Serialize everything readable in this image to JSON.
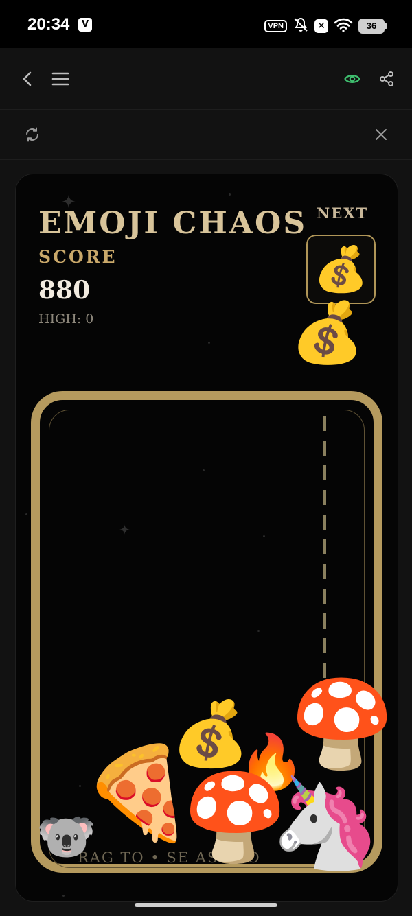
{
  "status_bar": {
    "time": "20:34",
    "app_badge": "V",
    "vpn": "VPN",
    "x_badge": "✕",
    "battery": "36"
  },
  "nav": {
    "back_icon": "chevron-left-icon",
    "menu_icon": "hamburger-menu-icon",
    "eye_icon": "eye-icon",
    "share_icon": "share-icon",
    "accent_color": "#3fbf6f"
  },
  "subbar": {
    "refresh_icon": "refresh-icon",
    "close_icon": "close-icon"
  },
  "game": {
    "title": "EMOJI CHAOS",
    "score_label": "SCORE",
    "score": "880",
    "high_score": "HIGH: 0",
    "next_label": "NEXT",
    "next_emoji": "💰",
    "hint": "RAG TO  •  SE ASE TO",
    "pieces": [
      "💰",
      "🍕",
      "💰",
      "🔥",
      "🍄",
      "🍄",
      "🦄",
      "🐨"
    ],
    "gold_color": "#b59a5e"
  }
}
